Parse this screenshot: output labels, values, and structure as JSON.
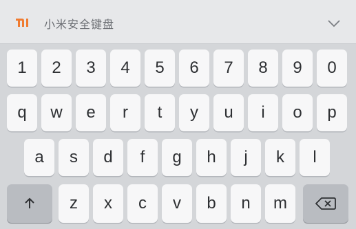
{
  "header": {
    "logo_text": "MI",
    "title": "小米安全键盘",
    "collapse_icon": "chevron-down-icon"
  },
  "rows": {
    "numbers": [
      "1",
      "2",
      "3",
      "4",
      "5",
      "6",
      "7",
      "8",
      "9",
      "0"
    ],
    "row1": [
      "q",
      "w",
      "e",
      "r",
      "t",
      "y",
      "u",
      "i",
      "o",
      "p"
    ],
    "row2": [
      "a",
      "s",
      "d",
      "f",
      "g",
      "h",
      "j",
      "k",
      "l"
    ],
    "row3": [
      "z",
      "x",
      "c",
      "v",
      "b",
      "n",
      "m"
    ]
  },
  "shift_icon": "arrow-up-icon",
  "backspace_icon": "backspace-icon",
  "colors": {
    "logo": "#f07b30",
    "key": "#f7f7f8",
    "dark_key": "#b9bcc1",
    "background": "#d4d6d9"
  }
}
